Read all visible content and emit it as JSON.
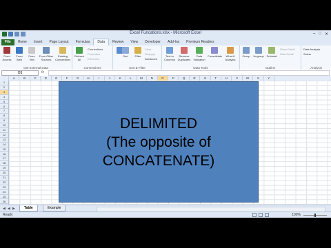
{
  "window": {
    "title": "Excel Funcations.xlsx - Microsoft Excel"
  },
  "tabs": [
    "File",
    "Home",
    "Insert",
    "Page Layout",
    "Formulas",
    "Data",
    "Review",
    "View",
    "Developer",
    "Add-Ins",
    "Premium Readers"
  ],
  "active_tab": "Data",
  "ribbon": {
    "get_external_data": {
      "label": "Get External Data",
      "buttons": [
        "From Access",
        "From Web",
        "From Text",
        "From Other Sources",
        "Existing Connections"
      ]
    },
    "connections": {
      "label": "Connections",
      "refresh": "Refresh All",
      "items": [
        "Connections",
        "Properties",
        "Edit Links"
      ]
    },
    "sort_filter": {
      "label": "Sort & Filter",
      "buttons": [
        "Sort",
        "Filter"
      ],
      "items": [
        "Clear",
        "Reapply",
        "Advanced"
      ]
    },
    "data_tools": {
      "label": "Data Tools",
      "buttons": [
        "Text to Columns",
        "Remove Duplicates",
        "Data Validation",
        "Consolidate",
        "What-If Analysis"
      ]
    },
    "outline": {
      "label": "Outline",
      "buttons": [
        "Group",
        "Ungroup",
        "Subtotal"
      ],
      "items": [
        "Show Detail",
        "Hide Detail"
      ]
    },
    "analysis": {
      "label": "Analysis",
      "items": [
        "Data Analysis",
        "Solver"
      ]
    }
  },
  "formula_bar": {
    "name_box": "O3",
    "fx": "fx",
    "value": ""
  },
  "columns": [
    "A",
    "B",
    "C",
    "D",
    "E",
    "F",
    "G",
    "H",
    "I",
    "J",
    "K",
    "L",
    "M",
    "N",
    "O",
    "P",
    "Q",
    "R",
    "S",
    "T",
    "U",
    "V",
    "W",
    "X",
    "Y"
  ],
  "selected_column": "O",
  "rows": [
    "1",
    "2",
    "3",
    "4",
    "5",
    "6",
    "7",
    "8",
    "9",
    "10",
    "11",
    "12",
    "13",
    "14",
    "15",
    "16",
    "17",
    "18",
    "19",
    "20",
    "21",
    "22",
    "23",
    "24",
    "25",
    "26"
  ],
  "selected_row": "3",
  "shape_text": [
    "DELIMITED",
    "(The opposite of",
    "CONCATENATE)"
  ],
  "sheets": [
    "Table",
    "Example"
  ],
  "active_sheet": "Table",
  "status": {
    "ready": "Ready",
    "zoom": "100%"
  },
  "colors": {
    "shape_fill": "#4f81bd",
    "file_tab": "#2a6e2a",
    "selection": "#f9d99a"
  }
}
